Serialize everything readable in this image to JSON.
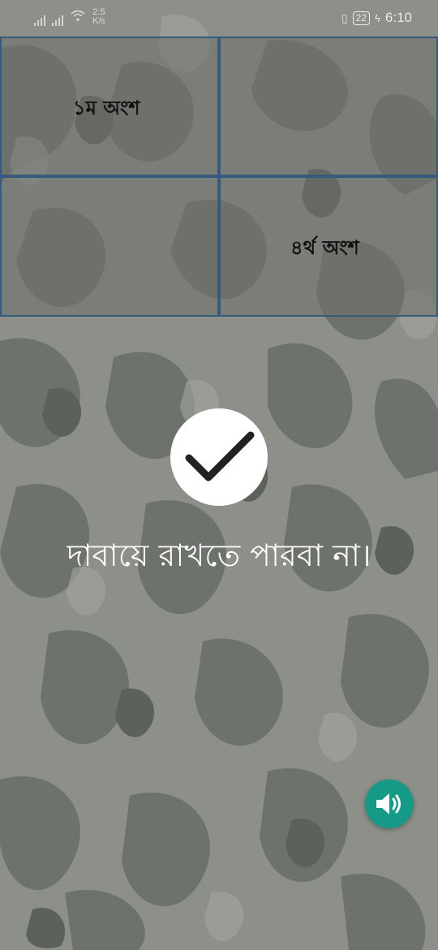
{
  "status_bar": {
    "net_speed_value": "2.5",
    "net_speed_unit": "K/s",
    "battery": "22",
    "time": "6:10"
  },
  "grid": {
    "cells": [
      {
        "label": "১ম অংশ"
      },
      {
        "label": ""
      },
      {
        "label": ""
      },
      {
        "label": "৪র্থ অংশ"
      }
    ],
    "border_color": "#355a7d"
  },
  "result": {
    "icon": "checkmark-icon",
    "message": "দাবায়ে রাখতে পারবা না।"
  },
  "sound_button": {
    "icon": "speaker-volume-icon",
    "color": "#169a88"
  }
}
